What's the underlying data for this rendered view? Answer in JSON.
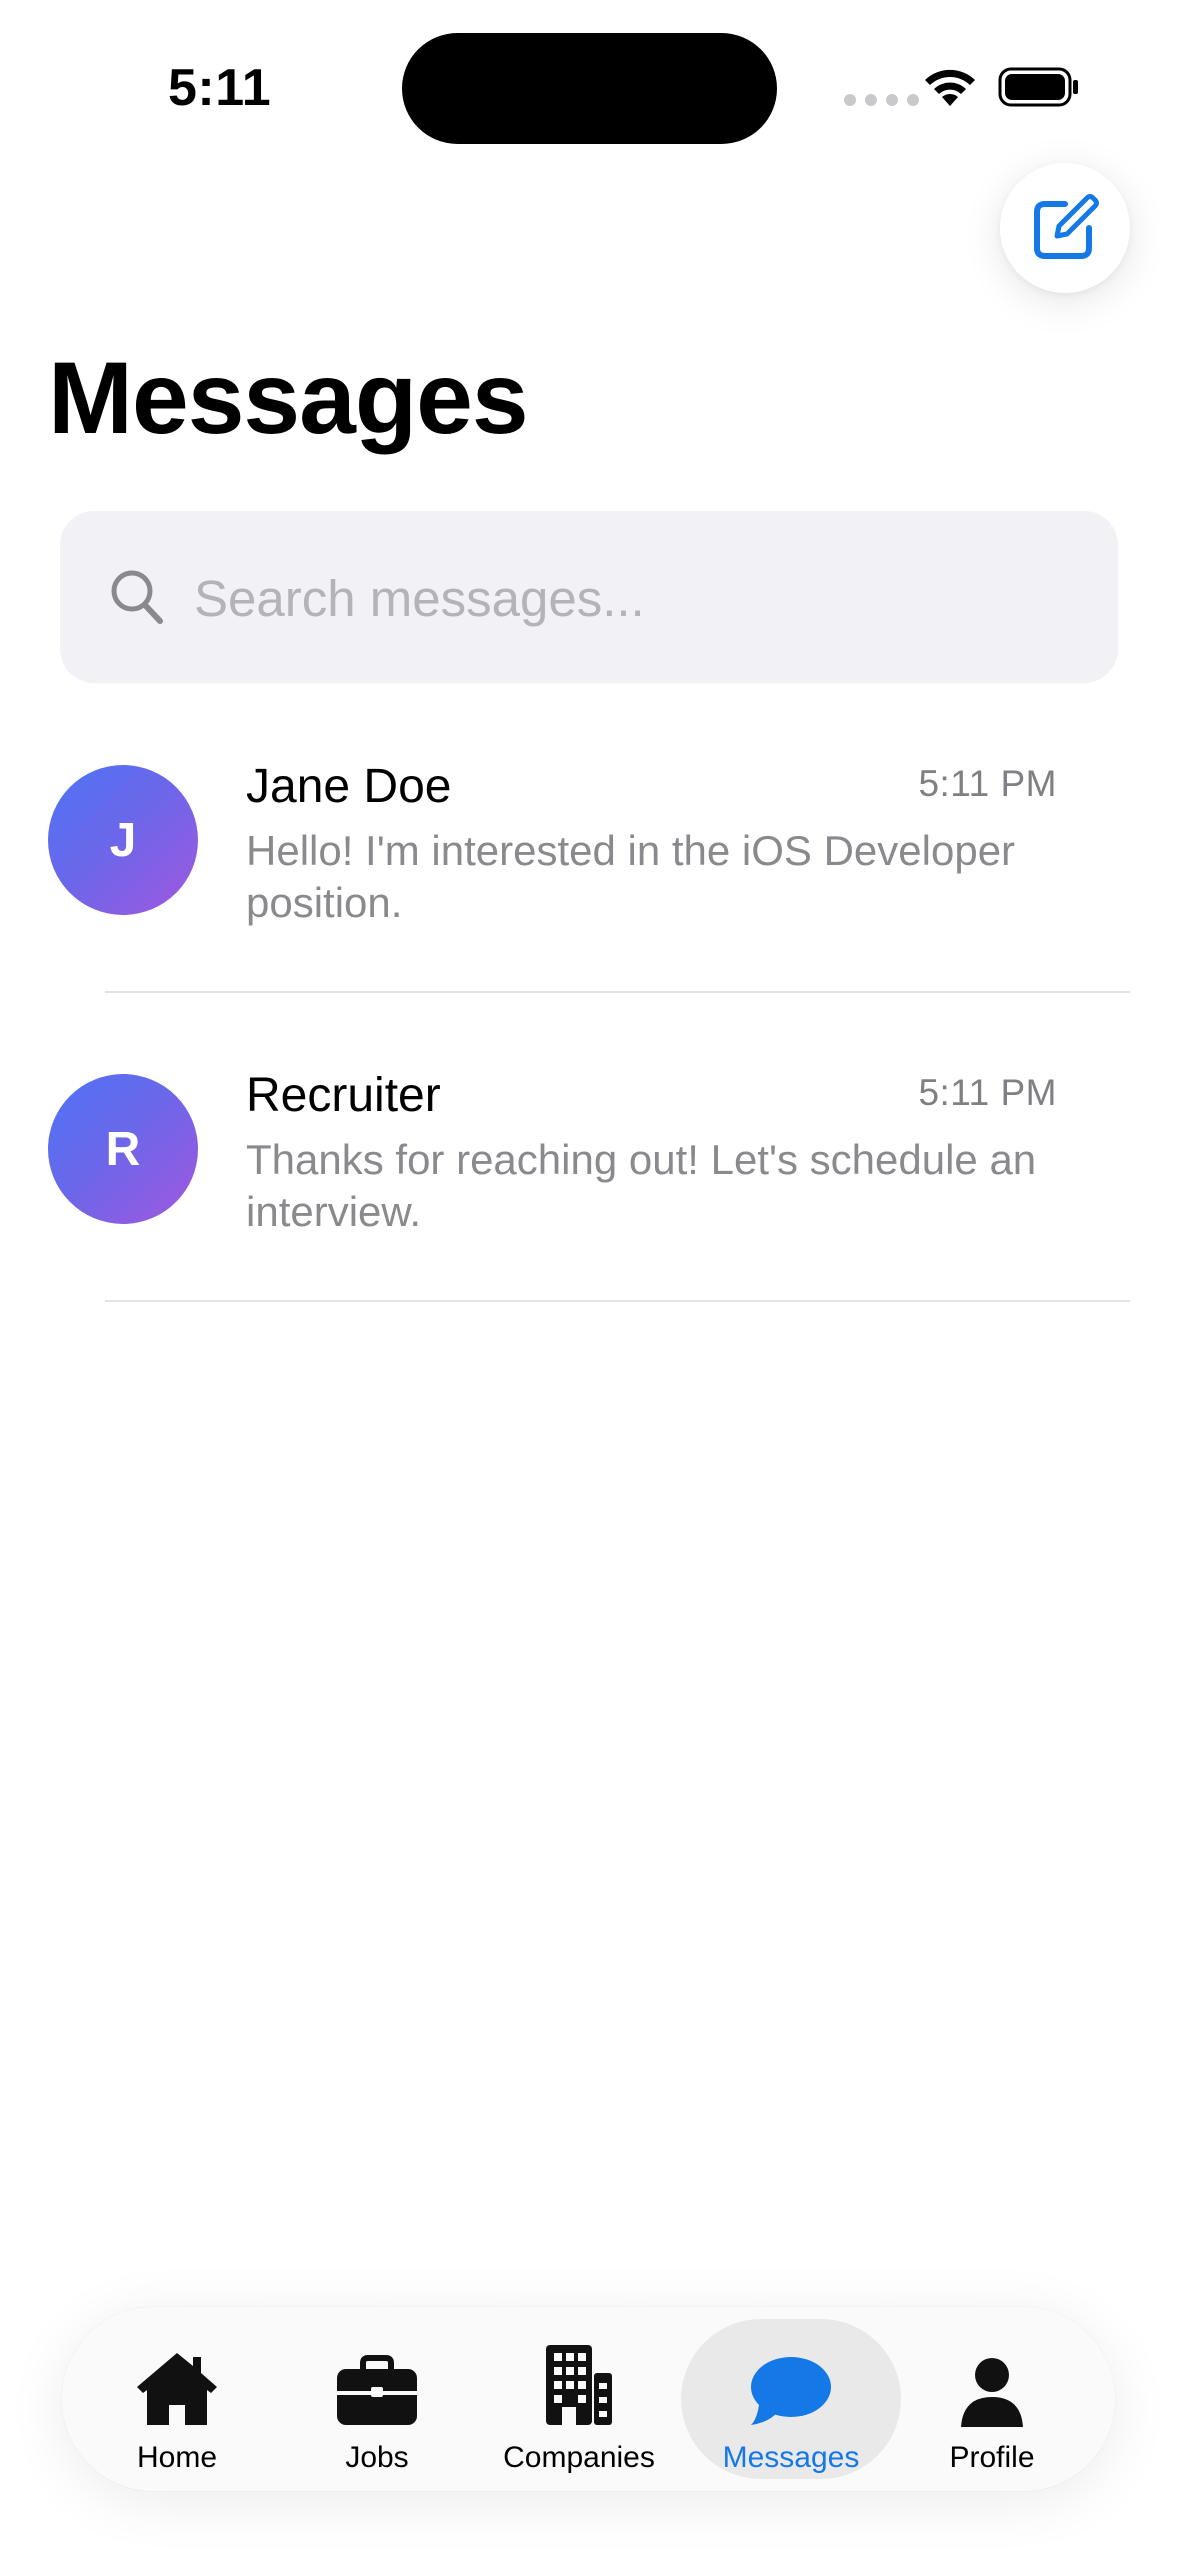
{
  "status_bar": {
    "time": "5:11"
  },
  "header": {
    "title": "Messages",
    "compose_icon": "compose-icon"
  },
  "search": {
    "placeholder": "Search messages..."
  },
  "conversations": [
    {
      "initial": "J",
      "name": "Jane Doe",
      "time": "5:11 PM",
      "preview": "Hello! I'm interested in the iOS Developer position."
    },
    {
      "initial": "R",
      "name": "Recruiter",
      "time": "5:11 PM",
      "preview": "Thanks for reaching out! Let's schedule an interview."
    }
  ],
  "tabs": [
    {
      "label": "Home",
      "icon": "house-icon"
    },
    {
      "label": "Jobs",
      "icon": "briefcase-icon"
    },
    {
      "label": "Companies",
      "icon": "building-icon"
    },
    {
      "label": "Messages",
      "icon": "chat-bubble-icon",
      "active": true
    },
    {
      "label": "Profile",
      "icon": "person-icon"
    }
  ],
  "colors": {
    "accent": "#1479e6",
    "avatar_gradient_start": "#4f74f6",
    "avatar_gradient_end": "#a257dd",
    "search_bg": "#f1f1f6"
  }
}
